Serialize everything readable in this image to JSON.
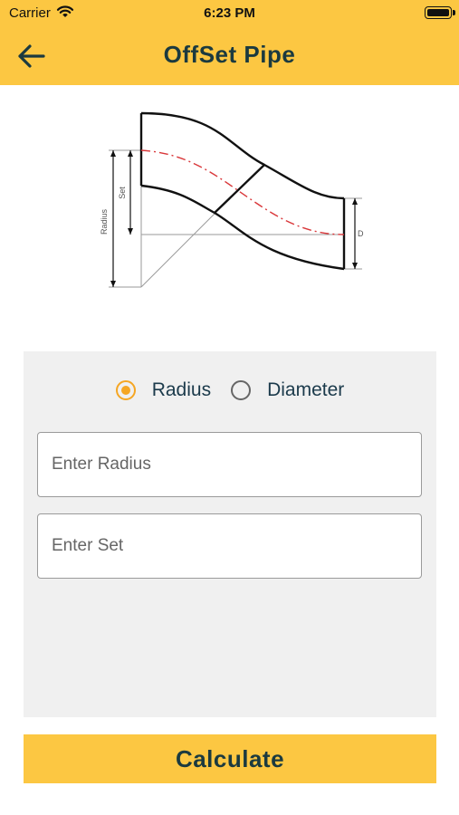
{
  "status_bar": {
    "carrier": "Carrier",
    "time": "6:23 PM"
  },
  "header": {
    "title": "OffSet Pipe",
    "back_icon": "arrow-left-icon"
  },
  "diagram": {
    "label_radius": "Radius",
    "label_set": "Set",
    "label_d": "D",
    "pipe_stroke_color": "#111111",
    "centerline_color": "#D9373A"
  },
  "form": {
    "radio_options": [
      {
        "label": "Radius",
        "selected": true
      },
      {
        "label": "Diameter",
        "selected": false
      }
    ],
    "radius_input": {
      "placeholder": "Enter Radius",
      "value": ""
    },
    "set_input": {
      "placeholder": "Enter Set",
      "value": ""
    }
  },
  "actions": {
    "calculate_label": "Calculate"
  },
  "colors": {
    "accent": "#FCC742",
    "radio_selected": "#F5A623",
    "title_text": "#1B3A3F",
    "panel_bg": "#F0F0F0"
  }
}
